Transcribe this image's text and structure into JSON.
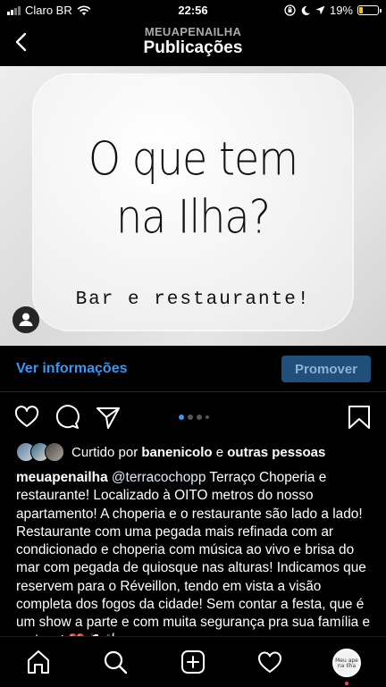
{
  "status_bar": {
    "carrier": "Claro BR",
    "time": "22:56",
    "battery_percent": "19%",
    "battery_color": "#f5c518"
  },
  "nav": {
    "subtitle": "MEUAPENAILHA",
    "title": "Publicações"
  },
  "post_image": {
    "title_line1": "O que tem",
    "title_line2": "na Ilha?",
    "subtitle": "Bar e restaurante!"
  },
  "insights": {
    "view_insights": "Ver informações",
    "promote": "Promover"
  },
  "actions": {
    "icons": [
      "heart-icon",
      "comment-icon",
      "share-icon",
      "bookmark-icon"
    ],
    "carousel_pages": 4,
    "carousel_active": 1
  },
  "likes": {
    "prefix": "Curtido por",
    "user": "banenicolo",
    "connector": "e",
    "others": "outras pessoas"
  },
  "caption": {
    "user": "meuapenailha",
    "mention": "@terracochopp",
    "text": "Terraço Choperia e restaurante! Localizado à OITO metros do nosso apartamento! A choperia e o restaurante são lado a lado! Restaurante com uma pegada mais refinada com ar condicionado e choperia com música ao vivo e brisa do mar com pegada de quiosque nas alturas! Indicamos que reservem para o Réveillon, tendo em vista a visão completa dos fogos da cidade! Sem contar a festa, que é um show a parte e com muita segurança pra sua família e amigos!",
    "emojis": "❤️🍻🍴"
  },
  "tabbar": {
    "icons": [
      "home-icon",
      "search-icon",
      "new-post-icon",
      "activity-icon",
      "profile-avatar"
    ],
    "profile_mini_text": "Meu ape na Ilha"
  },
  "colors": {
    "link_blue": "#3897f0",
    "promote_bg": "#1f4f7a",
    "background": "#000000"
  }
}
